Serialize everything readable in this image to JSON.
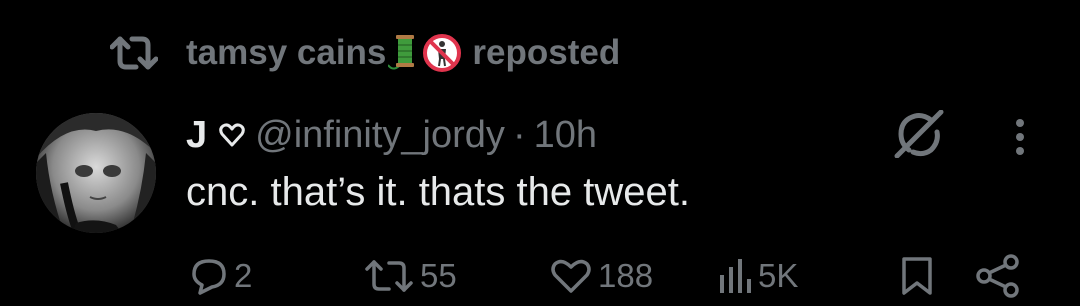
{
  "repost": {
    "icon": "repost-icon",
    "reposter_name": "tamsy cains",
    "emojis": [
      "thread-spool-emoji",
      "no-littering-emoji"
    ],
    "suffix": "reposted"
  },
  "tweet": {
    "avatar": "avatar-image",
    "display_name": "J",
    "name_emoji": "heart-outline-icon",
    "handle": "@infinity_jordy",
    "separator": "·",
    "time": "10h",
    "text": "cnc. that’s it. thats the tweet."
  },
  "actions": {
    "reply_count": "2",
    "repost_count": "55",
    "like_count": "188",
    "view_count": "5K"
  },
  "colors": {
    "background": "#000000",
    "text": "#e7e9ea",
    "muted": "#71767b"
  }
}
